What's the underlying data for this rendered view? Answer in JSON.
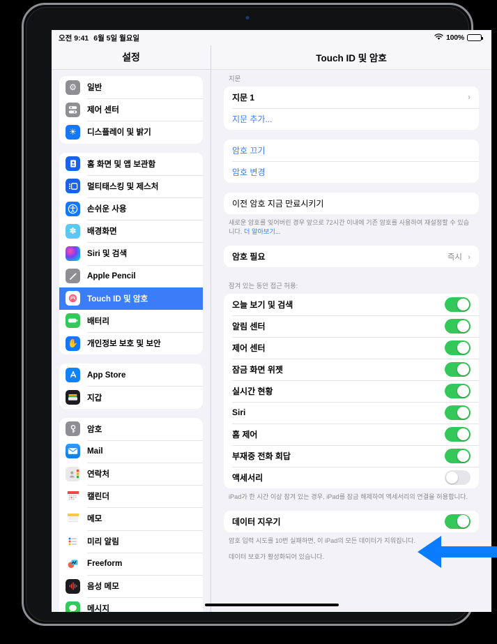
{
  "status_bar": {
    "time": "오전 9:41",
    "date": "6월 5일 월요일",
    "battery_percent": "100%",
    "wifi_icon": "wifi-icon",
    "battery_icon": "battery-full-icon"
  },
  "sidebar": {
    "title": "설정",
    "groups": [
      {
        "items": [
          {
            "label": "일반",
            "icon": "gear-icon",
            "icon_class": "ic-general",
            "glyph": "⚙",
            "selected": false
          },
          {
            "label": "제어 센터",
            "icon": "control-center-icon",
            "icon_class": "ic-control",
            "glyph": "⧉",
            "selected": false
          },
          {
            "label": "디스플레이 및 밝기",
            "icon": "brightness-icon",
            "icon_class": "ic-display",
            "glyph": "☀",
            "selected": false
          }
        ]
      },
      {
        "items": [
          {
            "label": "홈 화면 및 앱 보관함",
            "icon": "home-screen-icon",
            "icon_class": "ic-home",
            "glyph": "▤",
            "selected": false
          },
          {
            "label": "멀티태스킹 및 제스처",
            "icon": "multitasking-icon",
            "icon_class": "ic-multi",
            "glyph": "▣",
            "selected": false
          },
          {
            "label": "손쉬운 사용",
            "icon": "accessibility-icon",
            "icon_class": "ic-access",
            "glyph": "👤",
            "selected": false
          },
          {
            "label": "배경화면",
            "icon": "wallpaper-icon",
            "icon_class": "ic-wallpap",
            "glyph": "✽",
            "selected": false
          },
          {
            "label": "Siri 및 검색",
            "icon": "siri-icon",
            "icon_class": "ic-siri",
            "glyph": "",
            "selected": false
          },
          {
            "label": "Apple Pencil",
            "icon": "pencil-icon",
            "icon_class": "ic-pencil",
            "glyph": "✎",
            "selected": false
          },
          {
            "label": "Touch ID 및 암호",
            "icon": "touch-id-icon",
            "icon_class": "ic-touchid",
            "glyph": "◉",
            "selected": true
          },
          {
            "label": "배터리",
            "icon": "battery-icon",
            "icon_class": "ic-battery",
            "glyph": "▬",
            "selected": false
          },
          {
            "label": "개인정보 보호 및 보안",
            "icon": "privacy-hand-icon",
            "icon_class": "ic-privacy",
            "glyph": "✋",
            "selected": false
          }
        ]
      },
      {
        "items": [
          {
            "label": "App Store",
            "icon": "app-store-icon",
            "icon_class": "ic-appstore",
            "glyph": "Ⓐ",
            "selected": false
          },
          {
            "label": "지갑",
            "icon": "wallet-icon",
            "icon_class": "ic-wallet",
            "glyph": "▤",
            "selected": false
          }
        ]
      },
      {
        "items": [
          {
            "label": "암호",
            "icon": "key-icon",
            "icon_class": "ic-passwd",
            "glyph": "🗝",
            "selected": false
          },
          {
            "label": "Mail",
            "icon": "mail-icon",
            "icon_class": "ic-mail",
            "glyph": "✉",
            "selected": false
          },
          {
            "label": "연락처",
            "icon": "contacts-icon",
            "icon_class": "ic-contacts",
            "glyph": "👤",
            "selected": false
          },
          {
            "label": "캘린더",
            "icon": "calendar-icon",
            "icon_class": "ic-calendar",
            "glyph": "▦",
            "selected": false
          },
          {
            "label": "메모",
            "icon": "notes-icon",
            "icon_class": "ic-notes",
            "glyph": "▤",
            "selected": false
          },
          {
            "label": "미리 알림",
            "icon": "reminders-icon",
            "icon_class": "ic-remind",
            "glyph": "☰",
            "selected": false
          },
          {
            "label": "Freeform",
            "icon": "freeform-icon",
            "icon_class": "ic-freeform",
            "glyph": "∿",
            "selected": false
          },
          {
            "label": "음성 메모",
            "icon": "voice-memos-icon",
            "icon_class": "ic-voice",
            "glyph": "▮",
            "selected": false
          },
          {
            "label": "메시지",
            "icon": "messages-icon",
            "icon_class": "ic-message",
            "glyph": "💬",
            "selected": false
          }
        ]
      }
    ]
  },
  "detail": {
    "title": "Touch ID 및 암호",
    "fingerprint_caption": "지문",
    "fingerprint_rows": [
      {
        "label": "지문 1",
        "style": "bold",
        "chevron": "›"
      }
    ],
    "add_fingerprint_label": "지문 추가...",
    "passcode_actions": [
      {
        "label": "암호 끄기"
      },
      {
        "label": "암호 변경"
      }
    ],
    "expire_passcode_label": "이전 암호 지금 만료시키기",
    "expire_footer_text": "새로운 암호를 잊어버린 경우 앞으로 72시간 이내에 기존 암호를 사용하여 재설정할 수 있습니다. ",
    "expire_footer_link": "더 알아보기...",
    "require_passcode": {
      "label": "암호 필요",
      "value": "즉시",
      "chevron": "›"
    },
    "locked_access_caption": "잠겨 있는 동안 접근 허용:",
    "locked_access_toggles": [
      {
        "label": "오늘 보기 및 검색",
        "on": true
      },
      {
        "label": "알림 센터",
        "on": true
      },
      {
        "label": "제어 센터",
        "on": true
      },
      {
        "label": "잠금 화면 위젯",
        "on": true
      },
      {
        "label": "실시간 현황",
        "on": true
      },
      {
        "label": "Siri",
        "on": true
      },
      {
        "label": "홈 제어",
        "on": true
      },
      {
        "label": "부재중 전화 회답",
        "on": true
      },
      {
        "label": "액세서리",
        "on": false
      }
    ],
    "accessory_footer": "iPad가 한 시간 이상 잠겨 있는 경우, iPad를 잠금 해제하여 액세서리의 연결을 허용합니다.",
    "erase_data": {
      "label": "데이터 지우기",
      "on": true
    },
    "erase_footer_1": "암호 입력 시도를 10번 실패하면, 이 iPad의 모든 데이터가 지워집니다.",
    "erase_footer_2": "데이터 보호가 활성화되어 있습니다."
  },
  "annotation": {
    "arrow_color": "#0a7cff",
    "arrow_direction": "left",
    "points_to": "데이터 지우기"
  },
  "colors": {
    "accent_blue": "#3b7df6",
    "toggle_green": "#34c759",
    "toggle_off_gray": "#e6e6ea",
    "screen_bg": "#f2f2f7"
  }
}
